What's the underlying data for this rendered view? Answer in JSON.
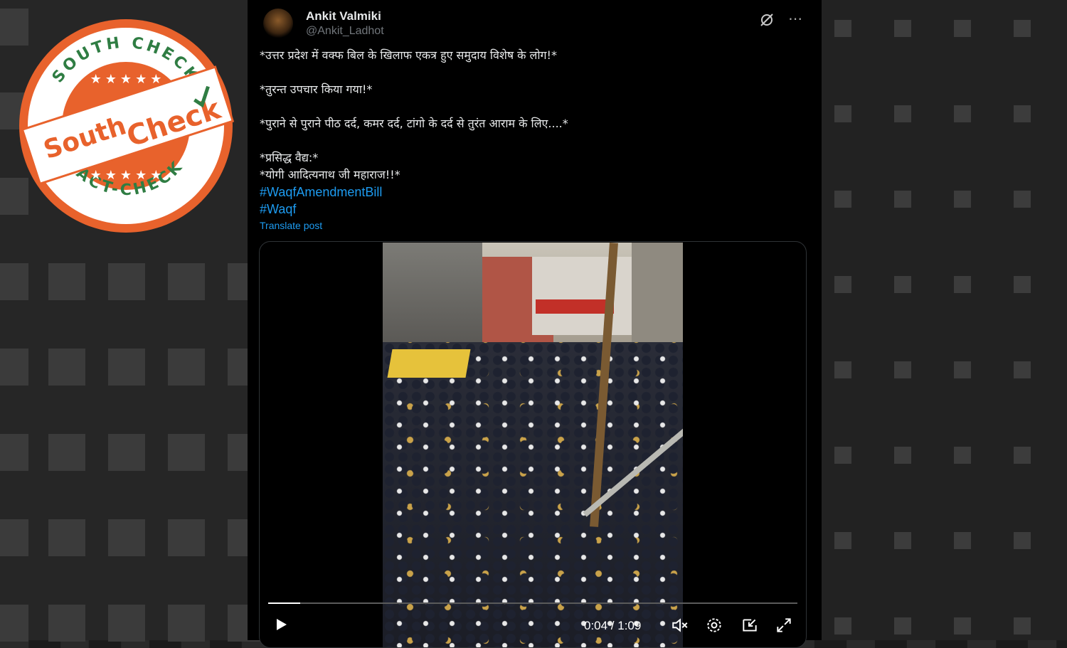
{
  "tweet": {
    "author_name": "Ankit Valmiki",
    "author_handle": "@Ankit_Ladhot",
    "lines": [
      "*उत्तर प्रदेश में वक्फ बिल के खिलाफ एकत्र हुए समुदाय विशेष के लोग!*",
      "*तुरन्त उपचार किया गया!*",
      "*पुराने से पुराने पीठ दर्द, कमर दर्द, टांगो के दर्द से तुरंत आराम के लिए....*",
      "*प्रसिद्ध वैद्य:*",
      "*योगी आदित्यनाथ जी महाराज!!*"
    ],
    "hashtags": [
      "#WaqfAmendmentBill",
      "#Waqf"
    ],
    "translate_label": "Translate post"
  },
  "video": {
    "current_time": "0:04",
    "duration": "1:09",
    "time_display": "0:04 / 1:09",
    "progress": 0.06
  },
  "stamp": {
    "top_text": "SOUTH CHECK",
    "bottom_text": "FACT-CHECK",
    "logo_part1": "South",
    "logo_part2": "Check"
  },
  "colors": {
    "background": "#000000",
    "text": "#e7e9ea",
    "link": "#1d9bf0",
    "handle": "#71767b",
    "stamp_orange": "#e8622c",
    "stamp_green": "#2f7d43"
  }
}
